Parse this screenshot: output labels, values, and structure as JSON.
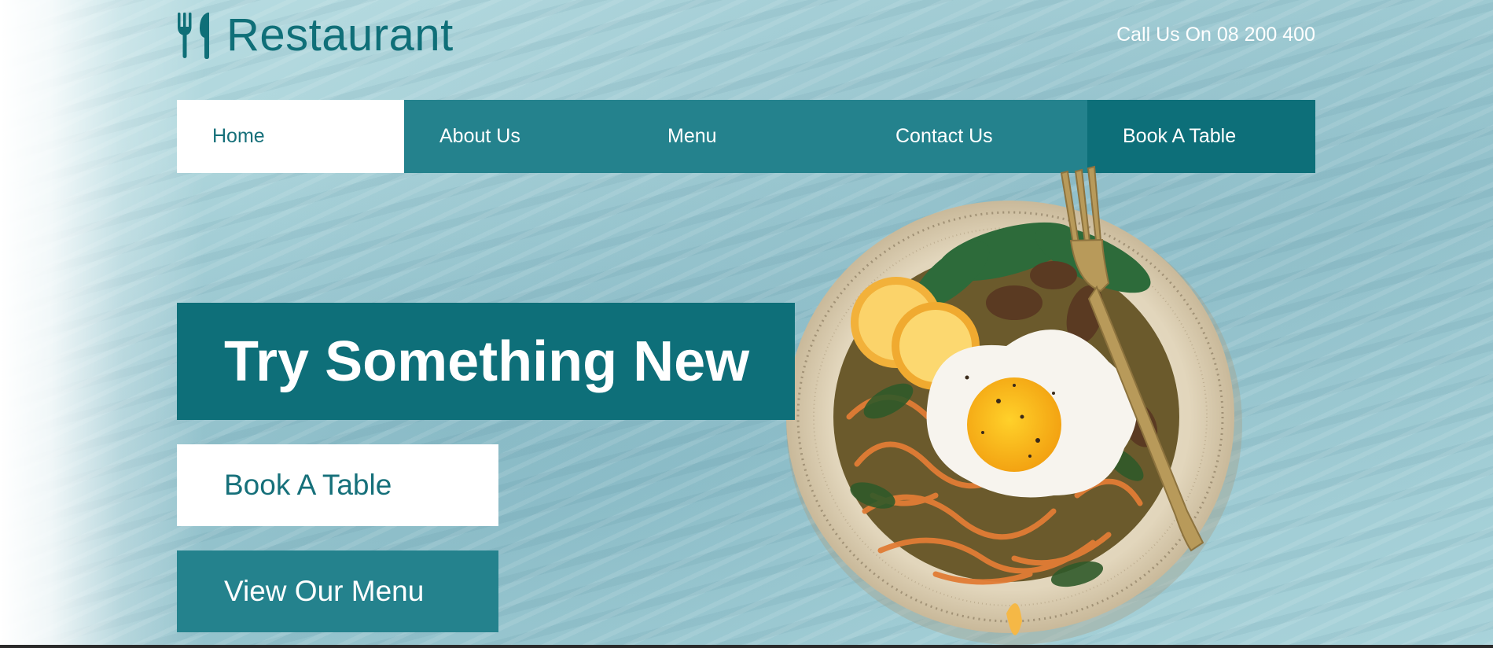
{
  "header": {
    "logo_text": "Restaurant",
    "logo_icon": "fork-spoon-icon",
    "phone_text": "Call Us On 08 200 400"
  },
  "nav": {
    "items": [
      {
        "label": "Home",
        "active": true
      },
      {
        "label": "About Us"
      },
      {
        "label": "Menu"
      },
      {
        "label": "Contact Us"
      },
      {
        "label": "Book A Table"
      }
    ]
  },
  "hero": {
    "title": "Try Something New",
    "book_button": "Book A Table",
    "menu_button": "View Our Menu",
    "image": "food-plate-image"
  },
  "colors": {
    "primary": "#0e6f79",
    "nav": "#24828d",
    "background": "#a7d1d8"
  }
}
